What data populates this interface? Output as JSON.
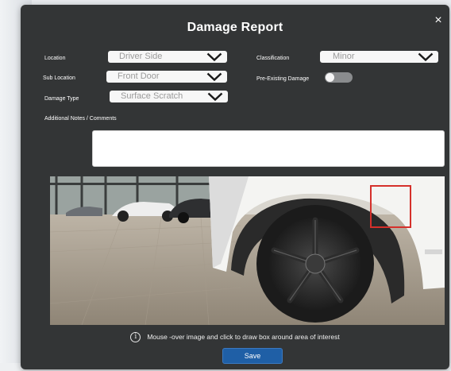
{
  "dialog": {
    "title": "Damage Report",
    "close_label": "×"
  },
  "form": {
    "location": {
      "label": "Location",
      "value": "Driver Side"
    },
    "sub_location": {
      "label": "Sub Location",
      "value": "Front Door"
    },
    "damage_type": {
      "label": "Damage Type",
      "value": "Surface Scratch"
    },
    "classification": {
      "label": "Classification",
      "value": "Minor"
    },
    "pre_existing": {
      "label": "Pre-Existing Damage",
      "checked": false
    },
    "notes": {
      "label": "Additional Notes / Comments",
      "value": ""
    }
  },
  "image": {
    "hint_icon": "info-icon",
    "hint": "Mouse -over image and click to draw box around area of interest",
    "annotation_color": "#d5302b"
  },
  "actions": {
    "save_label": "Save",
    "accent": "#1f5fa6"
  }
}
